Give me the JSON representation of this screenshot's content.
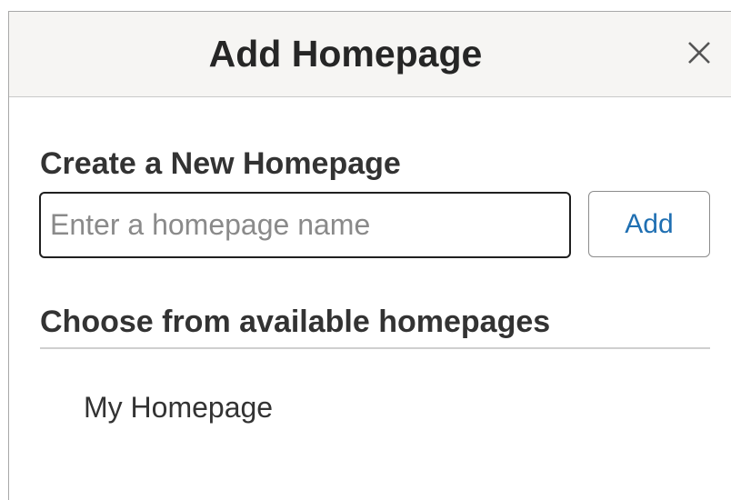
{
  "dialog": {
    "title": "Add Homepage",
    "close_icon": "close-icon"
  },
  "create_section": {
    "heading": "Create a New Homepage",
    "input_value": "",
    "input_placeholder": "Enter a homepage name",
    "add_label": "Add"
  },
  "choose_section": {
    "heading": "Choose from available homepages",
    "items": [
      {
        "label": "My Homepage"
      }
    ]
  },
  "colors": {
    "header_background": "#f6f5f3",
    "button_text": "#1f6fb2",
    "input_border": "#1f1f1f",
    "placeholder_text": "#8a8a8a"
  }
}
